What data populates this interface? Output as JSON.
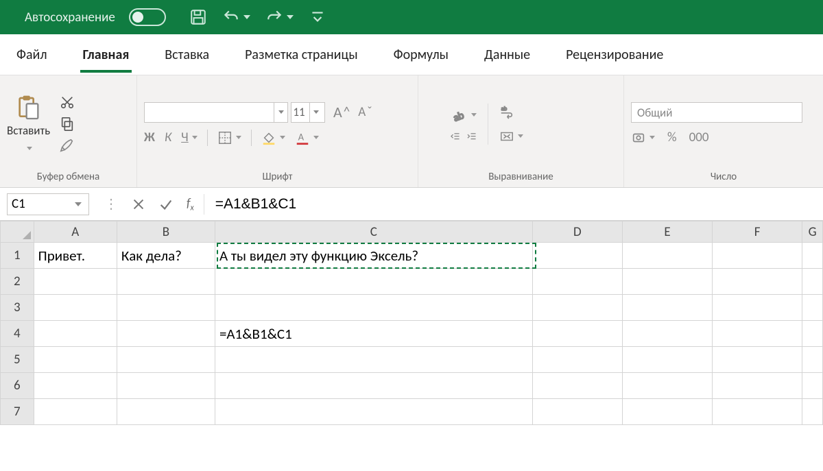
{
  "titlebar": {
    "autosave_label": "Автосохранение"
  },
  "tabs": [
    "Файл",
    "Главная",
    "Вставка",
    "Разметка страницы",
    "Формулы",
    "Данные",
    "Рецензирование"
  ],
  "active_tab_index": 1,
  "ribbon": {
    "clipboard": {
      "paste_label": "Вставить",
      "group_label": "Буфер обмена"
    },
    "font": {
      "size": "11",
      "group_label": "Шрифт",
      "bold": "Ж",
      "italic": "К",
      "underline": "Ч"
    },
    "alignment": {
      "group_label": "Выравнивание"
    },
    "number": {
      "format": "Общий",
      "group_label": "Число",
      "percent": "%",
      "thousands": "000"
    }
  },
  "formula_bar": {
    "name_box": "C1",
    "formula": "=A1&B1&C1"
  },
  "grid": {
    "columns": [
      "A",
      "B",
      "C",
      "D",
      "E",
      "F",
      "G"
    ],
    "rows": [
      "1",
      "2",
      "3",
      "4",
      "5",
      "6",
      "7"
    ],
    "cells": {
      "A1": "Привет.",
      "B1": "Как дела?",
      "C1": "А ты видел эту функцию Эксель?",
      "C4": "=A1&B1&C1"
    },
    "active_cell": "C1"
  }
}
